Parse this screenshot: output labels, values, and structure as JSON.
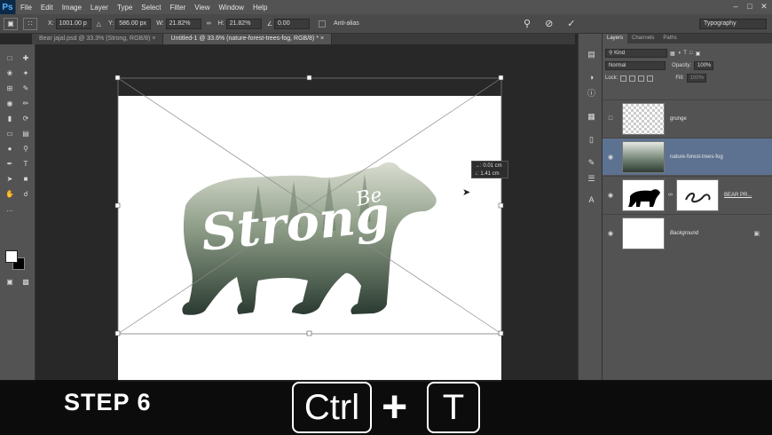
{
  "app": {
    "logo": "Ps"
  },
  "menu": [
    "File",
    "Edit",
    "Image",
    "Layer",
    "Type",
    "Select",
    "Filter",
    "View",
    "Window",
    "Help"
  ],
  "options": {
    "x_label": "X:",
    "x_value": "1001.00 p",
    "y_label": "Y:",
    "y_value": "586.00 px",
    "w_label": "W:",
    "w_value": "21.82%",
    "h_label": "H:",
    "h_value": "21.82%",
    "angle_value": "0.00",
    "antialias_label": "Anti-alias",
    "workspace": "Typography"
  },
  "tabs": [
    {
      "label": "Bear jajal.psd @ 33.3% (Strong, RGB/8)",
      "close": "×"
    },
    {
      "label": "Untitled-1 @ 33.6% (nature-forest-trees-fog, RGB/8) *",
      "close": "×"
    }
  ],
  "canvas": {
    "be_text": "Be",
    "strong_text": "Strong",
    "info_line1": "→: 0.01 cm",
    "info_line2": "↓: 1.41 cm"
  },
  "panel": {
    "tabs": [
      "Layers",
      "Channels",
      "Paths"
    ],
    "kind_label": "Kind",
    "blend_mode": "Normal",
    "opacity_label": "Opacity:",
    "opacity_value": "100%",
    "lock_label": "Lock:",
    "fill_label": "Fill:",
    "fill_value": "100%",
    "layers": [
      {
        "name": "grunge",
        "visible": false
      },
      {
        "name": "nature-forest-trees-fog",
        "visible": true,
        "selected": true
      },
      {
        "name": "BEAR PR...",
        "visible": true
      },
      {
        "name": "Background",
        "visible": true
      }
    ]
  },
  "overlay": {
    "step": "STEP 6",
    "key1": "Ctrl",
    "plus": "+",
    "key2": "T"
  },
  "colors": {
    "accent_selected": "#5d7291",
    "overlay_bg": "#0a0a0a"
  }
}
